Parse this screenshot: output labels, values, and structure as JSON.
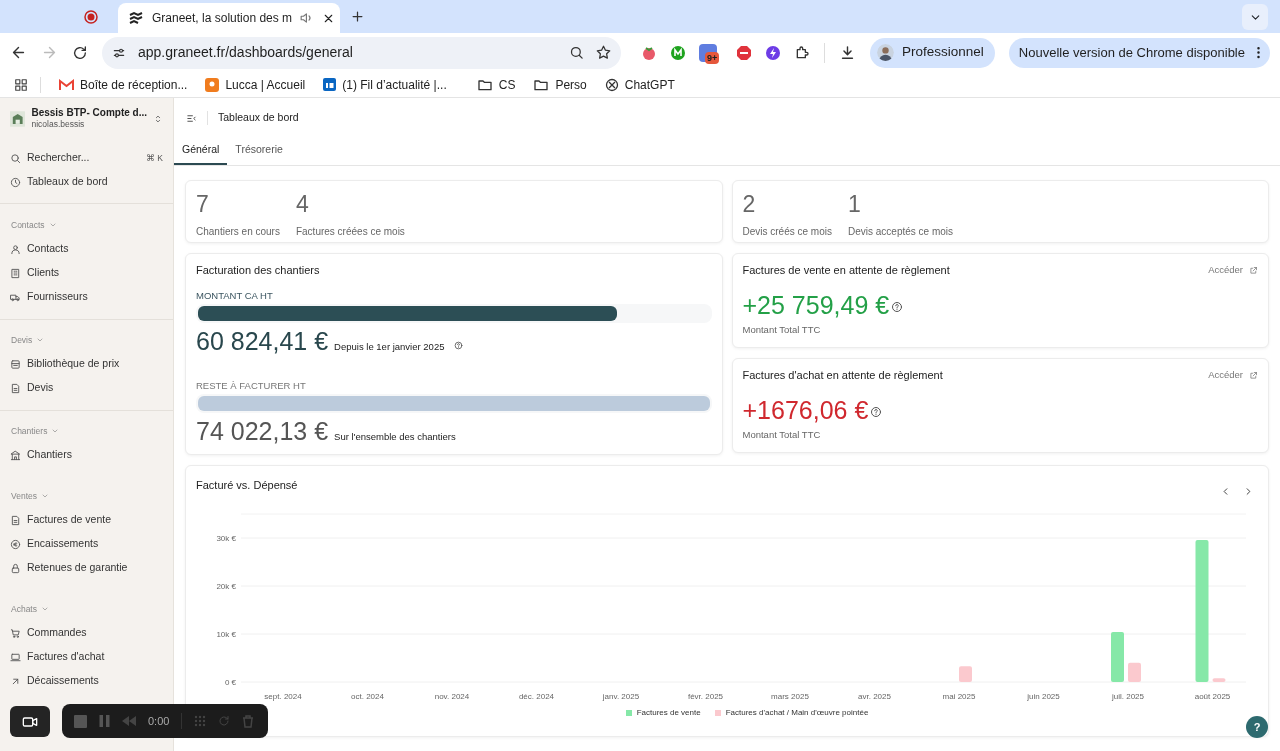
{
  "browser": {
    "tabs": [
      {
        "title": "Graneet, la solution des m",
        "selected": true,
        "audio": true
      }
    ],
    "url": "app.graneet.fr/dashboards/general",
    "extension_badge": "9+",
    "profile_button": "Professionnel",
    "update_button": "Nouvelle version de Chrome disponible",
    "bookmarks": [
      {
        "label": "Boîte de réception..."
      },
      {
        "label": "Lucca | Accueil"
      },
      {
        "label": "(1) Fil d’actualité |..."
      },
      {
        "label": "CS"
      },
      {
        "label": "Perso"
      },
      {
        "label": "ChatGPT"
      }
    ]
  },
  "sidebar": {
    "org": {
      "name": "Bessis BTP- Compte d...",
      "user": "nicolas.bessis"
    },
    "search": {
      "label": "Rechercher...",
      "shortcut": "⌘ K"
    },
    "top_items": [
      {
        "label": "Tableaux de bord"
      }
    ],
    "sections": [
      {
        "title": "Contacts",
        "items": [
          {
            "label": "Contacts"
          },
          {
            "label": "Clients"
          },
          {
            "label": "Fournisseurs"
          }
        ]
      },
      {
        "title": "Devis",
        "items": [
          {
            "label": "Bibliothèque de prix"
          },
          {
            "label": "Devis"
          }
        ]
      },
      {
        "title": "Chantiers",
        "items": [
          {
            "label": "Chantiers"
          }
        ]
      },
      {
        "title": "Ventes",
        "items": [
          {
            "label": "Factures de vente"
          },
          {
            "label": "Encaissements"
          },
          {
            "label": "Retenues de garantie"
          }
        ]
      },
      {
        "title": "Achats",
        "items": [
          {
            "label": "Commandes"
          },
          {
            "label": "Factures d'achat"
          },
          {
            "label": "Décaissements"
          }
        ]
      }
    ]
  },
  "header": {
    "title": "Tableaux de bord"
  },
  "tabs": [
    {
      "label": "Général",
      "selected": true
    },
    {
      "label": "Trésorerie",
      "selected": false
    }
  ],
  "stats": [
    [
      {
        "value": "7",
        "label": "Chantiers en cours"
      },
      {
        "value": "4",
        "label": "Factures créées ce mois"
      }
    ],
    [
      {
        "value": "2",
        "label": "Devis créés ce mois"
      },
      {
        "value": "1",
        "label": "Devis acceptés ce mois"
      }
    ]
  ],
  "billing": {
    "title": "Facturation des chantiers",
    "metrics": [
      {
        "label": "MONTANT CA HT",
        "level": 0.82,
        "amount": "60 824,41 €",
        "note": "Depuis le 1er janvier 2025",
        "help": true,
        "kind": "dark"
      },
      {
        "label": "RESTE À FACTURER HT",
        "level": 1,
        "amount": "74 022,13 €",
        "note": "Sur l'ensemble des chantiers",
        "help": false,
        "kind": "light"
      }
    ]
  },
  "pending": [
    {
      "title": "Factures de vente en attente de règlement",
      "link": "Accéder",
      "amount": "+25 759,49 €",
      "color": "#23a047",
      "caption": "Montant Total TTC"
    },
    {
      "title": "Factures d'achat en attente de règlement",
      "link": "Accéder",
      "amount": "+1676,06 €",
      "color": "#d0282e",
      "caption": "Montant Total TTC"
    }
  ],
  "chart_card": {
    "title": "Facturé vs. Dépensé",
    "chart_data": {
      "type": "bar",
      "grid": true,
      "categories": [
        "sept. 2024",
        "oct. 2024",
        "nov. 2024",
        "déc. 2024",
        "janv. 2025",
        "févr. 2025",
        "mars 2025",
        "avr. 2025",
        "mai 2025",
        "juin 2025",
        "juil. 2025",
        "août 2025"
      ],
      "series": [
        {
          "name": "Factures de vente",
          "color": "#86e8a8",
          "values": [
            0,
            0,
            0,
            0,
            0,
            0,
            0,
            0,
            0,
            0,
            10400,
            29600
          ]
        },
        {
          "name": "Factures d'achat / Main d'œuvre pointée",
          "color": "#fbc9ce",
          "values": [
            0,
            0,
            0,
            0,
            0,
            0,
            0,
            0,
            3300,
            0,
            4000,
            800
          ]
        }
      ],
      "ylim": [
        0,
        35000
      ],
      "yticks": [
        {
          "value": 0,
          "label": "0 €"
        },
        {
          "value": 10000,
          "label": "10k €"
        },
        {
          "value": 20000,
          "label": "20k €"
        },
        {
          "value": 30000,
          "label": "30k €"
        }
      ]
    }
  },
  "recorder": {
    "time": "0:00"
  },
  "help_button": "?"
}
